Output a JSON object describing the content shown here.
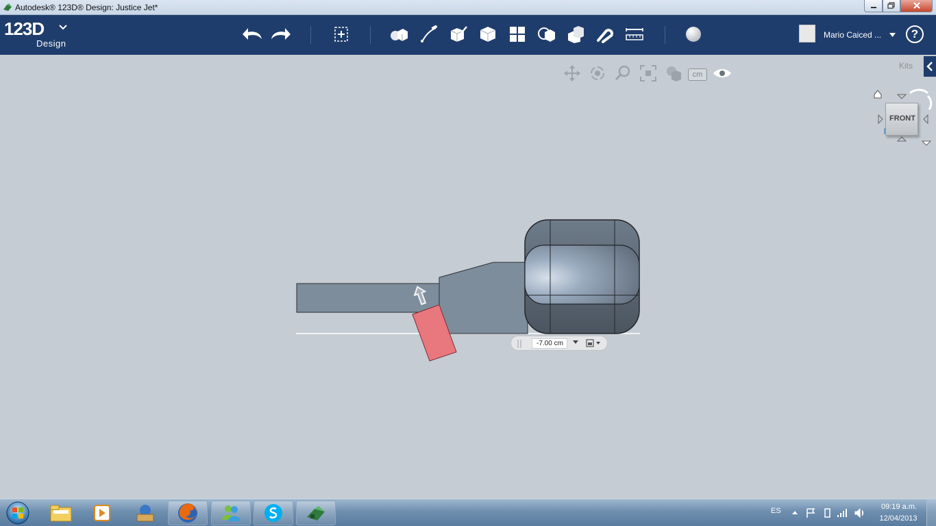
{
  "window": {
    "title": "Autodesk® 123D® Design: Justice Jet*"
  },
  "app": {
    "logo_main": "123D",
    "logo_sub": "Design"
  },
  "toolbar": {
    "tools": [
      "undo-icon",
      "redo-icon",
      "transform-icon",
      "primitives-icon",
      "sketch-icon",
      "construct-icon",
      "modify-icon",
      "pattern-icon",
      "grouping-icon",
      "combine-icon",
      "snap-icon",
      "measure-icon",
      "material-icon"
    ]
  },
  "user": {
    "name": "Mario Caiced ...",
    "help": "?"
  },
  "viewport": {
    "units": "cm",
    "kits": "Kits",
    "viewcube_face": "FRONT",
    "dimension_value": "-7.00 cm"
  },
  "colors": {
    "toolbar_bg": "#1f3d6c",
    "canvas_bg": "#c6ccd3",
    "selected_face": "#e9777e"
  },
  "taskbar": {
    "lang": "ES",
    "time": "09:19 a.m.",
    "date": "12/04/2013",
    "apps": [
      "windows-explorer",
      "media-player",
      "app-tray",
      "firefox",
      "messenger",
      "skype",
      "123d-design"
    ]
  }
}
